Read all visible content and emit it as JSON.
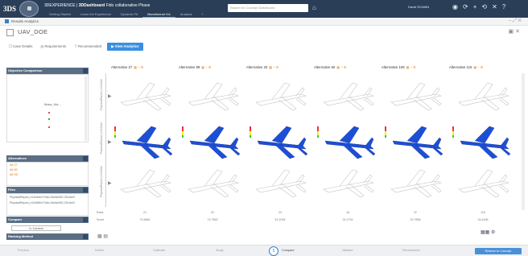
{
  "app": {
    "brand": "3DS",
    "title_prefix": "3DEXPERIENCE |",
    "title_app": "3DDashboard",
    "title_suffix": "Fido collaborative Phase",
    "tabs": [
      "Getting Started",
      "Learn the Experience",
      "Dynamic Fit",
      "Manufacture KA",
      "Analysis",
      "+"
    ],
    "active_tab_index": 3,
    "search_placeholder": "Search for Concept Dashboard",
    "user_name": "David ROAMN"
  },
  "window": {
    "title": "Results Analytics"
  },
  "study": {
    "name": "UAV_DOE"
  },
  "subtabs": [
    "Case Details",
    "Requirements",
    "Recommended",
    "View Analytics"
  ],
  "active_subtab_index": 3,
  "left_panel": {
    "objective_header": "Objective Comparison",
    "objective_label": "Mass_Ma...",
    "alternatives_header": "Alternatives",
    "alternatives": [
      "Alt 27",
      "Alt 80",
      "Alt 56"
    ],
    "files_header": "Files",
    "files": [
      "PhysicalReport_e1444ee3 Fallo-SketchBO-2Sc4e4f",
      "PhysicalReport_e14456e3 Fallo-SketchBO-2Sc4e4f"
    ],
    "compare_header": "Compare",
    "compare_value": "In Context",
    "ranking_header": "Ranking Method"
  },
  "grid": {
    "columns": [
      "Alternative 27",
      "Alternative 88",
      "Alternative 25",
      "Alternative 60",
      "Alternative 108",
      "Alternative 115"
    ],
    "row_labels": [
      "PhysicalReport_e1444ee",
      "PhysicalReport_e1444ee",
      "PhysicalReport_e1444ee"
    ],
    "rank_label": "Rank",
    "score_label": "Score",
    "ranks": [
      "21",
      "22",
      "23",
      "16",
      "37",
      "115"
    ],
    "scores": [
      "74.5664",
      "74.7563",
      "51.1094",
      "24.1734",
      "22.7656",
      "24.4496"
    ]
  },
  "footer": {
    "steps": [
      "Process",
      "Define",
      "Calibrate",
      "Study",
      "Compare",
      "Validate",
      "Recommend"
    ],
    "active_step_index": 4,
    "active_step_number": "5",
    "button_label": "Restore to Concept"
  },
  "colors": {
    "topbar": "#2b3e58",
    "accent": "#3b8fe0",
    "mesh": "#1d4fd6"
  }
}
